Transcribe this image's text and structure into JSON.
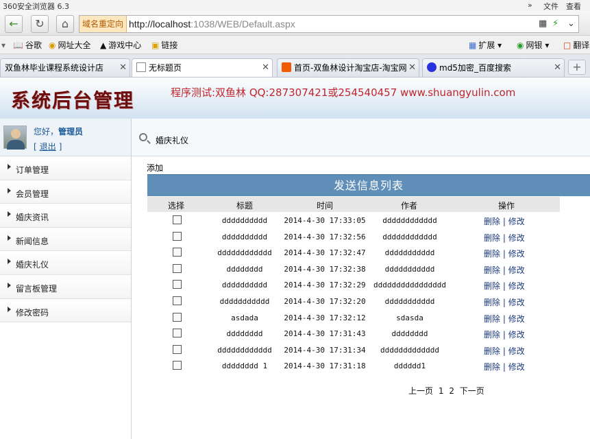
{
  "browser": {
    "title": "360安全浏览器 6.3",
    "menu": [
      "»",
      "文件",
      "查看"
    ],
    "redirect_label": "域名重定向",
    "url_host": "http://localhost",
    "url_rest": ":1038/WEB/Default.aspx",
    "favorites": [
      {
        "icon": "book-icon",
        "label": "谷歌"
      },
      {
        "icon": "globe-icon",
        "label": "网址大全"
      },
      {
        "icon": "gamepad-icon",
        "label": "游戏中心"
      },
      {
        "icon": "folder-icon",
        "label": "链接"
      },
      {
        "icon": "grid-icon",
        "label": "扩展"
      },
      {
        "icon": "bank-icon",
        "label": "网银"
      },
      {
        "icon": "translate-icon",
        "label": "翻译"
      }
    ],
    "tabs": [
      {
        "label": "双鱼林毕业课程系统设计店",
        "active": false
      },
      {
        "label": "无标题页",
        "active": true
      },
      {
        "label": "首页-双鱼林设计淘宝店-淘宝网",
        "active": false
      },
      {
        "label": "md5加密_百度搜索",
        "active": false
      }
    ]
  },
  "site": {
    "brand": "系统后台管理",
    "tester": "程序测试:双鱼林 QQ:287307421或254540457 www.shuangyulin.com"
  },
  "sidebar": {
    "greeting": "您好，",
    "user": "管理员",
    "logout": "退出",
    "items": [
      "订单管理",
      "会员管理",
      "婚庆资讯",
      "新闻信息",
      "婚庆礼仪",
      "留言板管理",
      "修改密码"
    ]
  },
  "main": {
    "crumb": "婚庆礼仪",
    "add_label": "添加",
    "table_title": "发送信息列表",
    "columns": [
      "选择",
      "标题",
      "时间",
      "作者",
      "操作"
    ],
    "rows": [
      {
        "title": "dddddddddd",
        "time": "2014-4-30  17:33:05",
        "author": "dddddddddddd"
      },
      {
        "title": "dddddddddd",
        "time": "2014-4-30  17:32:56",
        "author": "dddddddddddd"
      },
      {
        "title": "dddddddddddd",
        "time": "2014-4-30  17:32:47",
        "author": "ddddddddddd"
      },
      {
        "title": "dddddddd",
        "time": "2014-4-30  17:32:38",
        "author": "ddddddddddd"
      },
      {
        "title": "dddddddddd",
        "time": "2014-4-30  17:32:29",
        "author": "dddddddddddddddd"
      },
      {
        "title": "ddddddddddd",
        "time": "2014-4-30  17:32:20",
        "author": "ddddddddddd"
      },
      {
        "title": "asdada",
        "time": "2014-4-30  17:32:12",
        "author": "sdasda"
      },
      {
        "title": "dddddddd",
        "time": "2014-4-30  17:31:43",
        "author": "dddddddd"
      },
      {
        "title": "dddddddddddd",
        "time": "2014-4-30  17:31:34",
        "author": "ddddddddddddd"
      },
      {
        "title": "dddddddd 1",
        "time": "2014-4-30  17:31:18",
        "author": "dddddd1"
      }
    ],
    "delete_label": "删除",
    "separator": "|",
    "edit_label": "修改",
    "pager": {
      "prev": "上一页",
      "page1": "1",
      "page2": "2",
      "next": "下一页"
    }
  }
}
